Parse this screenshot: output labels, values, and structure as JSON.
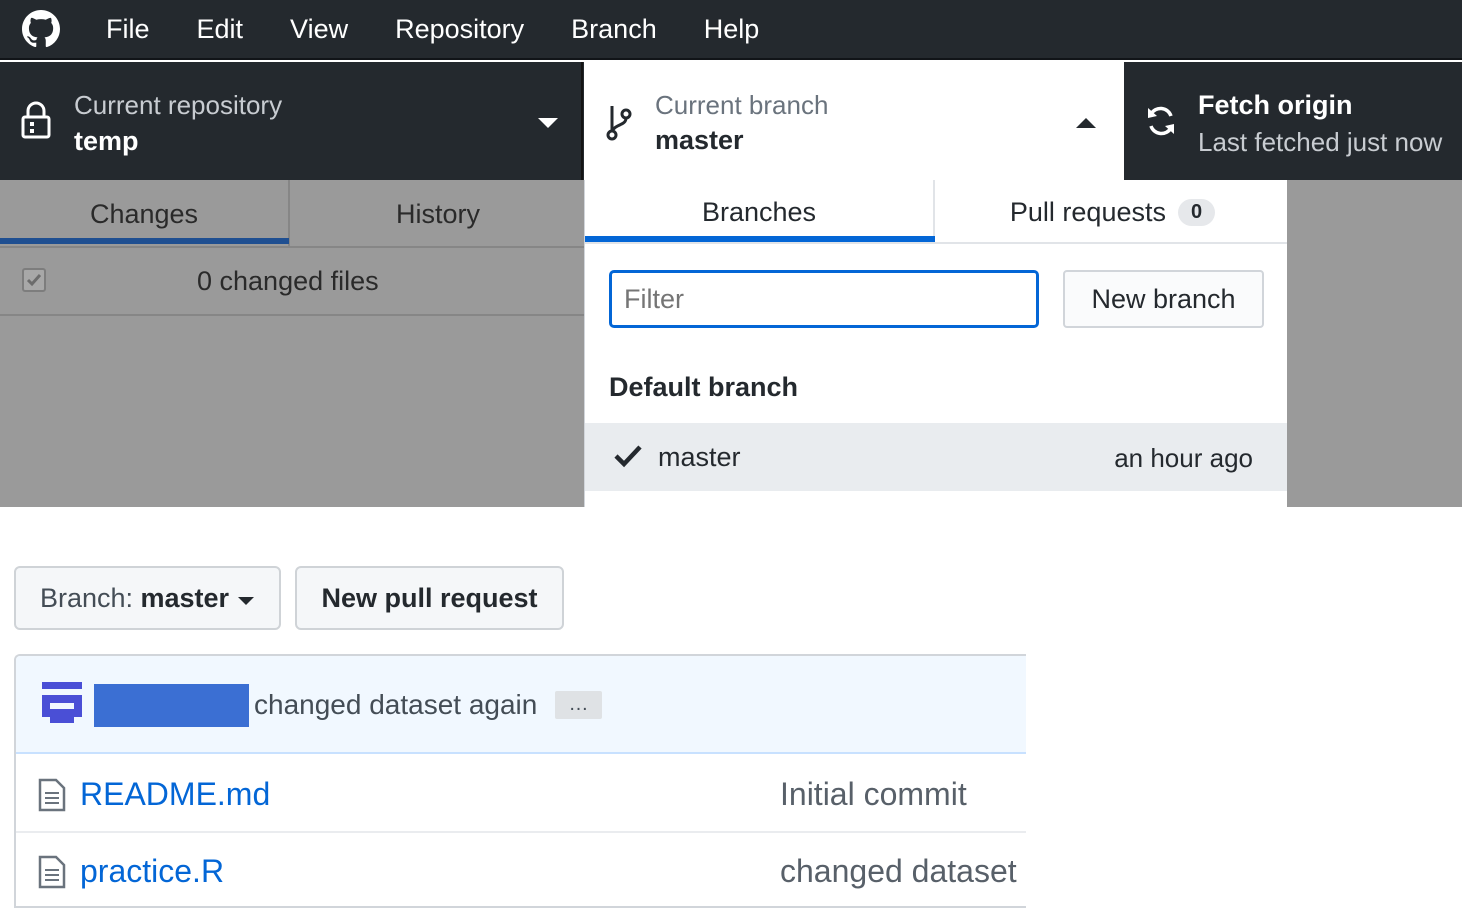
{
  "menu": [
    "File",
    "Edit",
    "View",
    "Repository",
    "Branch",
    "Help"
  ],
  "toolbar": {
    "repo_title": "Current repository",
    "repo_name": "temp",
    "branch_title": "Current branch",
    "branch_name": "master",
    "fetch_title": "Fetch origin",
    "fetch_sub": "Last fetched just now"
  },
  "left": {
    "tabs": [
      "Changes",
      "History"
    ],
    "changed_files": "0 changed files"
  },
  "dropdown": {
    "tab_branches": "Branches",
    "tab_pull_requests": "Pull requests",
    "pull_request_count": "0",
    "filter_placeholder": "Filter",
    "new_branch": "New branch",
    "section_title": "Default branch",
    "branch_item": "master",
    "branch_time": "an hour ago"
  },
  "web": {
    "branch_label": "Branch: ",
    "branch_value": "master",
    "new_pr": "New pull request",
    "commit_message": "changed dataset again",
    "ellipsis": "…",
    "files": [
      {
        "name": "README.md",
        "message": "Initial commit"
      },
      {
        "name": "practice.R",
        "message": "changed dataset"
      }
    ]
  },
  "colors": {
    "dark_bar": "#24292e",
    "accent": "#0366d6",
    "dim_overlay": "#9a9a9a",
    "redaction": "#3b6fd3"
  }
}
